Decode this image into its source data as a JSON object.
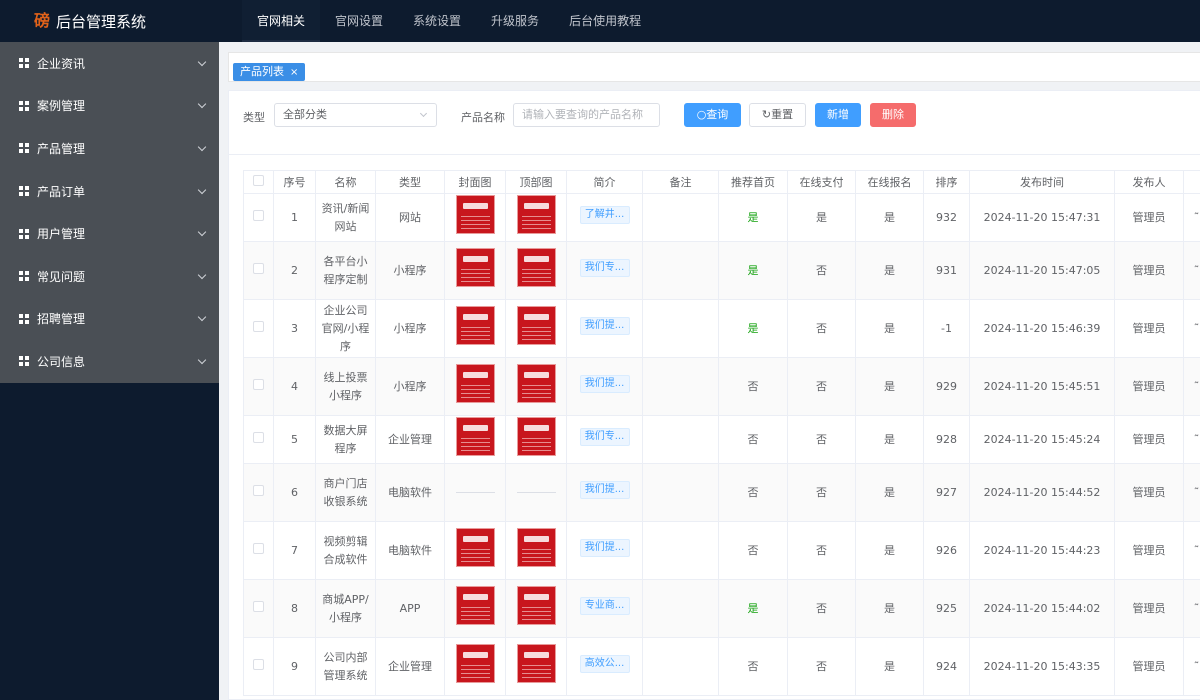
{
  "app": {
    "title": "后台管理系统",
    "logo_char": "磅"
  },
  "topnav": [
    {
      "label": "官网相关",
      "active": true
    },
    {
      "label": "官网设置",
      "active": false
    },
    {
      "label": "系统设置",
      "active": false
    },
    {
      "label": "升级服务",
      "active": false
    },
    {
      "label": "后台使用教程",
      "active": false
    }
  ],
  "sidebar": {
    "items": [
      {
        "label": "企业资讯"
      },
      {
        "label": "案例管理"
      },
      {
        "label": "产品管理"
      },
      {
        "label": "产品订单"
      },
      {
        "label": "用户管理"
      },
      {
        "label": "常见问题"
      },
      {
        "label": "招聘管理"
      },
      {
        "label": "公司信息"
      }
    ]
  },
  "tab": {
    "label": "产品列表",
    "close": "×"
  },
  "filter": {
    "type_label": "类型",
    "type_value": "全部分类",
    "name_label": "产品名称",
    "name_placeholder": "请输入要查询的产品名称",
    "query_label": "查询",
    "reset_label": "重置",
    "add_label": "新增",
    "delete_label": "删除"
  },
  "table": {
    "headers": [
      "",
      "序号",
      "名称",
      "类型",
      "封面图",
      "顶部图",
      "简介",
      "备注",
      "推荐首页",
      "在线支付",
      "在线报名",
      "排序",
      "发布时间",
      "发布人",
      ""
    ],
    "rows": [
      {
        "no": "1",
        "name": "资讯/新闻网站",
        "type": "网站",
        "cover": true,
        "top": true,
        "intro": "了解井...",
        "remark": "",
        "recommend": "是",
        "pay": "是",
        "signup": "是",
        "sort": "932",
        "time": "2024-11-20 15:47:31",
        "author": "管理员"
      },
      {
        "no": "2",
        "name": "各平台小程序定制",
        "type": "小程序",
        "cover": true,
        "top": true,
        "intro": "我们专...",
        "remark": "",
        "recommend": "是",
        "pay": "否",
        "signup": "是",
        "sort": "931",
        "time": "2024-11-20 15:47:05",
        "author": "管理员"
      },
      {
        "no": "3",
        "name": "企业公司官网/小程序",
        "type": "小程序",
        "cover": true,
        "top": true,
        "intro": "我们提...",
        "remark": "",
        "recommend": "是",
        "pay": "否",
        "signup": "是",
        "sort": "-1",
        "time": "2024-11-20 15:46:39",
        "author": "管理员"
      },
      {
        "no": "4",
        "name": "线上投票小程序",
        "type": "小程序",
        "cover": true,
        "top": true,
        "intro": "我们提...",
        "remark": "",
        "recommend": "否",
        "pay": "否",
        "signup": "是",
        "sort": "929",
        "time": "2024-11-20 15:45:51",
        "author": "管理员"
      },
      {
        "no": "5",
        "name": "数据大屏程序",
        "type": "企业管理",
        "cover": true,
        "top": true,
        "intro": "我们专...",
        "remark": "",
        "recommend": "否",
        "pay": "否",
        "signup": "是",
        "sort": "928",
        "time": "2024-11-20 15:45:24",
        "author": "管理员"
      },
      {
        "no": "6",
        "name": "商户门店收银系统",
        "type": "电脑软件",
        "cover": false,
        "top": false,
        "intro": "我们提...",
        "remark": "",
        "recommend": "否",
        "pay": "否",
        "signup": "是",
        "sort": "927",
        "time": "2024-11-20 15:44:52",
        "author": "管理员"
      },
      {
        "no": "7",
        "name": "视频剪辑合成软件",
        "type": "电脑软件",
        "cover": true,
        "top": true,
        "intro": "我们提...",
        "remark": "",
        "recommend": "否",
        "pay": "否",
        "signup": "是",
        "sort": "926",
        "time": "2024-11-20 15:44:23",
        "author": "管理员"
      },
      {
        "no": "8",
        "name": "商城APP/小程序",
        "type": "APP",
        "cover": true,
        "top": true,
        "intro": "专业商...",
        "remark": "",
        "recommend": "是",
        "pay": "否",
        "signup": "是",
        "sort": "925",
        "time": "2024-11-20 15:44:02",
        "author": "管理员"
      },
      {
        "no": "9",
        "name": "公司内部管理系统",
        "type": "企业管理",
        "cover": true,
        "top": true,
        "intro": "高效公...",
        "remark": "",
        "recommend": "否",
        "pay": "否",
        "signup": "是",
        "sort": "924",
        "time": "2024-11-20 15:43:35",
        "author": "管理员"
      }
    ]
  },
  "colors": {
    "accent": "#409eff",
    "danger": "#f56c6c",
    "sidebar_bg": "#0d1b2e",
    "menu_bg": "#4a4f55",
    "green": "#13a10e"
  }
}
